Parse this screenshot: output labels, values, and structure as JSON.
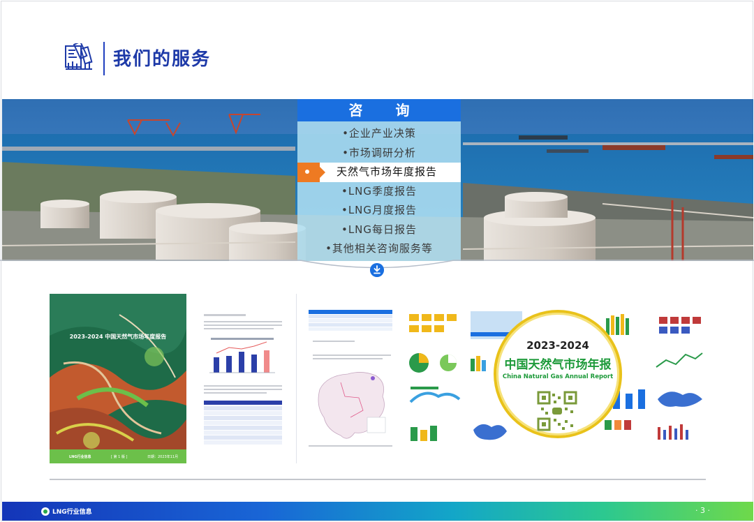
{
  "header": {
    "title": "我们的服务"
  },
  "menu": {
    "heading": "咨 询",
    "items": [
      {
        "label": "•企业产业决策",
        "active": false
      },
      {
        "label": "•市场调研分析",
        "active": false
      },
      {
        "label": "天然气市场年度报告",
        "active": true
      },
      {
        "label": "•LNG季度报告",
        "active": false
      },
      {
        "label": "•LNG月度报告",
        "active": false
      },
      {
        "label": "•LNG每日报告",
        "active": false
      },
      {
        "label": "•其他相关咨询服务等",
        "active": false
      }
    ]
  },
  "report_cover": {
    "title": "2023-2024 中国天然气市场年度报告",
    "brand": "LNG行业信息",
    "edition": "[ 第 1 版 ]",
    "date": "日期：2023年11月"
  },
  "badge": {
    "years": "2023-2024",
    "title": "中国天然气市场年报",
    "subtitle": "China Natural Gas Annual Report"
  },
  "footer": {
    "brand": "LNG行业信息",
    "page_number": "· 3 ·"
  },
  "icons": {
    "title_icon": "document-chart-icon",
    "down_icon": "download-arrow-icon",
    "footer_logo": "brand-logo-icon"
  },
  "colors": {
    "primary_blue": "#1a6fe0",
    "title_blue": "#1e3aa8",
    "accent_orange": "#ee7a22",
    "brand_green": "#1d9a3a",
    "badge_gold": "#e9c21a"
  }
}
